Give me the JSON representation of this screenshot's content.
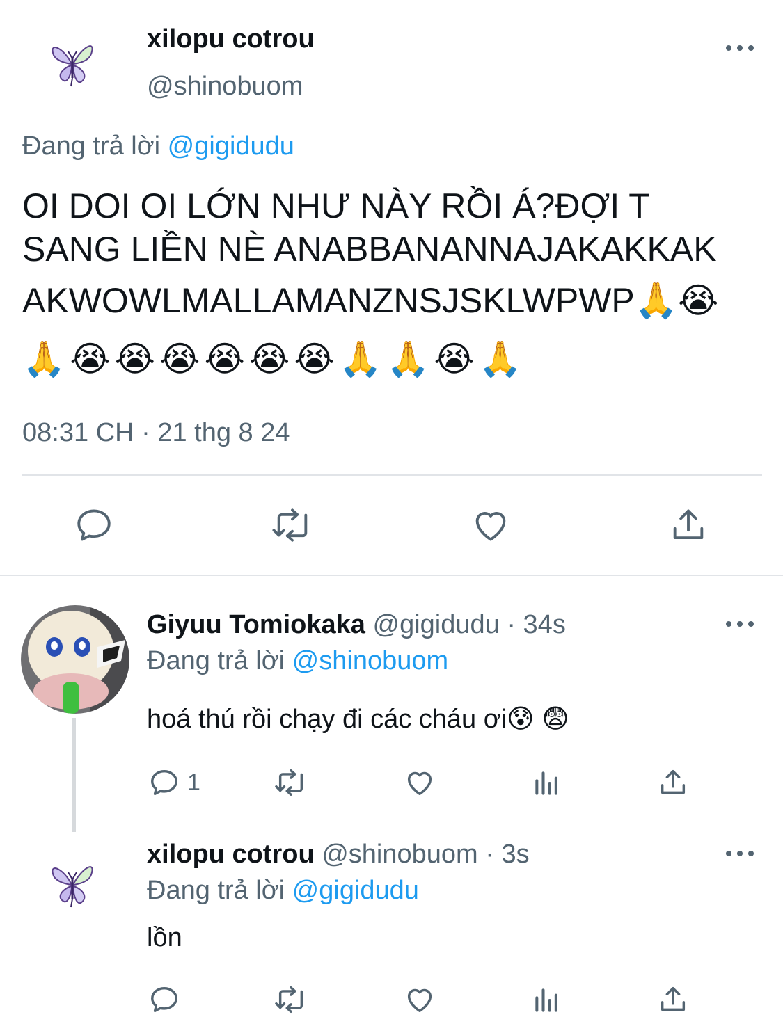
{
  "main_tweet": {
    "display_name": "xilopu cotrou",
    "handle": "@shinobuom",
    "replying_prefix": "Đang trả lời",
    "replying_to": "@gigidudu",
    "text_line1": "OI DOI OI LỚN NHƯ NÀY RỒI Á?ĐỢI T",
    "text_line2": "SANG LIỀN NÈ ANABBANANNAJAKAKKAK",
    "text_line3": "AKWOWLMALLAMANZNSJSKLWPWP🙏😭",
    "emoji_line": "🙏😭😭😭😭😭😭🙏🙏😭🙏",
    "timestamp": "08:31 CH · 21 thg 8 24",
    "actions": [
      "reply-icon",
      "retweet-icon",
      "like-icon",
      "share-icon"
    ]
  },
  "reply_1": {
    "display_name": "Giyuu Tomiokaka",
    "handle": "@gigidudu",
    "sep": "·",
    "time": "34s",
    "replying_prefix": "Đang trả lời",
    "replying_to": "@shinobuom",
    "text": "hoá thú rồi chạy đi các cháu ơi😰 😨",
    "reply_count": "1",
    "actions": [
      "reply-icon",
      "retweet-icon",
      "like-icon",
      "views-icon",
      "share-icon"
    ]
  },
  "reply_2": {
    "display_name": "xilopu cotrou",
    "handle": "@shinobuom",
    "sep": "·",
    "time": "3s",
    "replying_prefix": "Đang trả lời",
    "replying_to": "@gigidudu",
    "text": "lồn",
    "actions": [
      "reply-icon",
      "retweet-icon",
      "like-icon",
      "views-icon",
      "share-icon"
    ]
  },
  "colors": {
    "link": "#1d9bf0",
    "muted": "#536471",
    "text": "#0f1419",
    "divider": "#e1e4e8"
  }
}
